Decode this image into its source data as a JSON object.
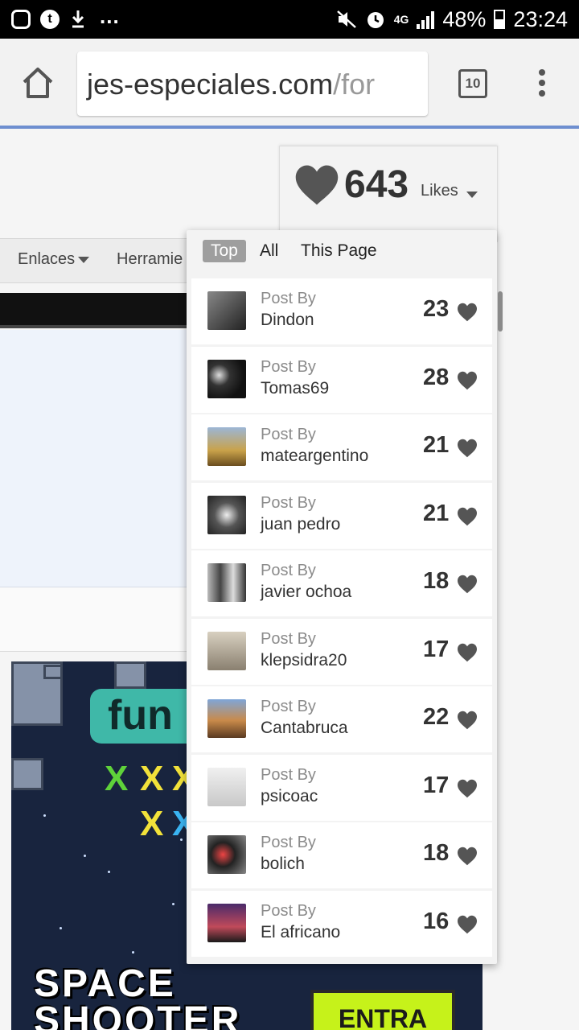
{
  "status_bar": {
    "icons": [
      "instagram-icon",
      "tumblr-icon",
      "download-icon",
      "more-dots"
    ],
    "more": "...",
    "network": "4G",
    "battery": "48%",
    "time": "23:24"
  },
  "browser": {
    "url_main": "jes-especiales.com",
    "url_rest": "/for",
    "tab_count": "10"
  },
  "site_nav": {
    "items": [
      "Enlaces",
      "Herramie"
    ]
  },
  "likes_widget": {
    "count": "643",
    "label": "Likes",
    "tabs": [
      "Top",
      "All",
      "This Page"
    ],
    "active_tab": "Top",
    "entries": [
      {
        "post_by": "Post By",
        "user": "Dindon",
        "count": "23"
      },
      {
        "post_by": "Post By",
        "user": "Tomas69",
        "count": "28"
      },
      {
        "post_by": "Post By",
        "user": "mateargentino",
        "count": "21"
      },
      {
        "post_by": "Post By",
        "user": "juan pedro",
        "count": "21"
      },
      {
        "post_by": "Post By",
        "user": "javier ochoa",
        "count": "18"
      },
      {
        "post_by": "Post By",
        "user": "klepsidra20",
        "count": "17"
      },
      {
        "post_by": "Post By",
        "user": "Cantabruca",
        "count": "22"
      },
      {
        "post_by": "Post By",
        "user": "psicoac",
        "count": "17"
      },
      {
        "post_by": "Post By",
        "user": "bolich",
        "count": "18"
      },
      {
        "post_by": "Post By",
        "user": "El africano",
        "count": "16"
      }
    ]
  },
  "ad": {
    "brand": "fun",
    "title_line1": "SPACE",
    "title_line2": "SHOOTER",
    "cta": "ENTRA"
  }
}
